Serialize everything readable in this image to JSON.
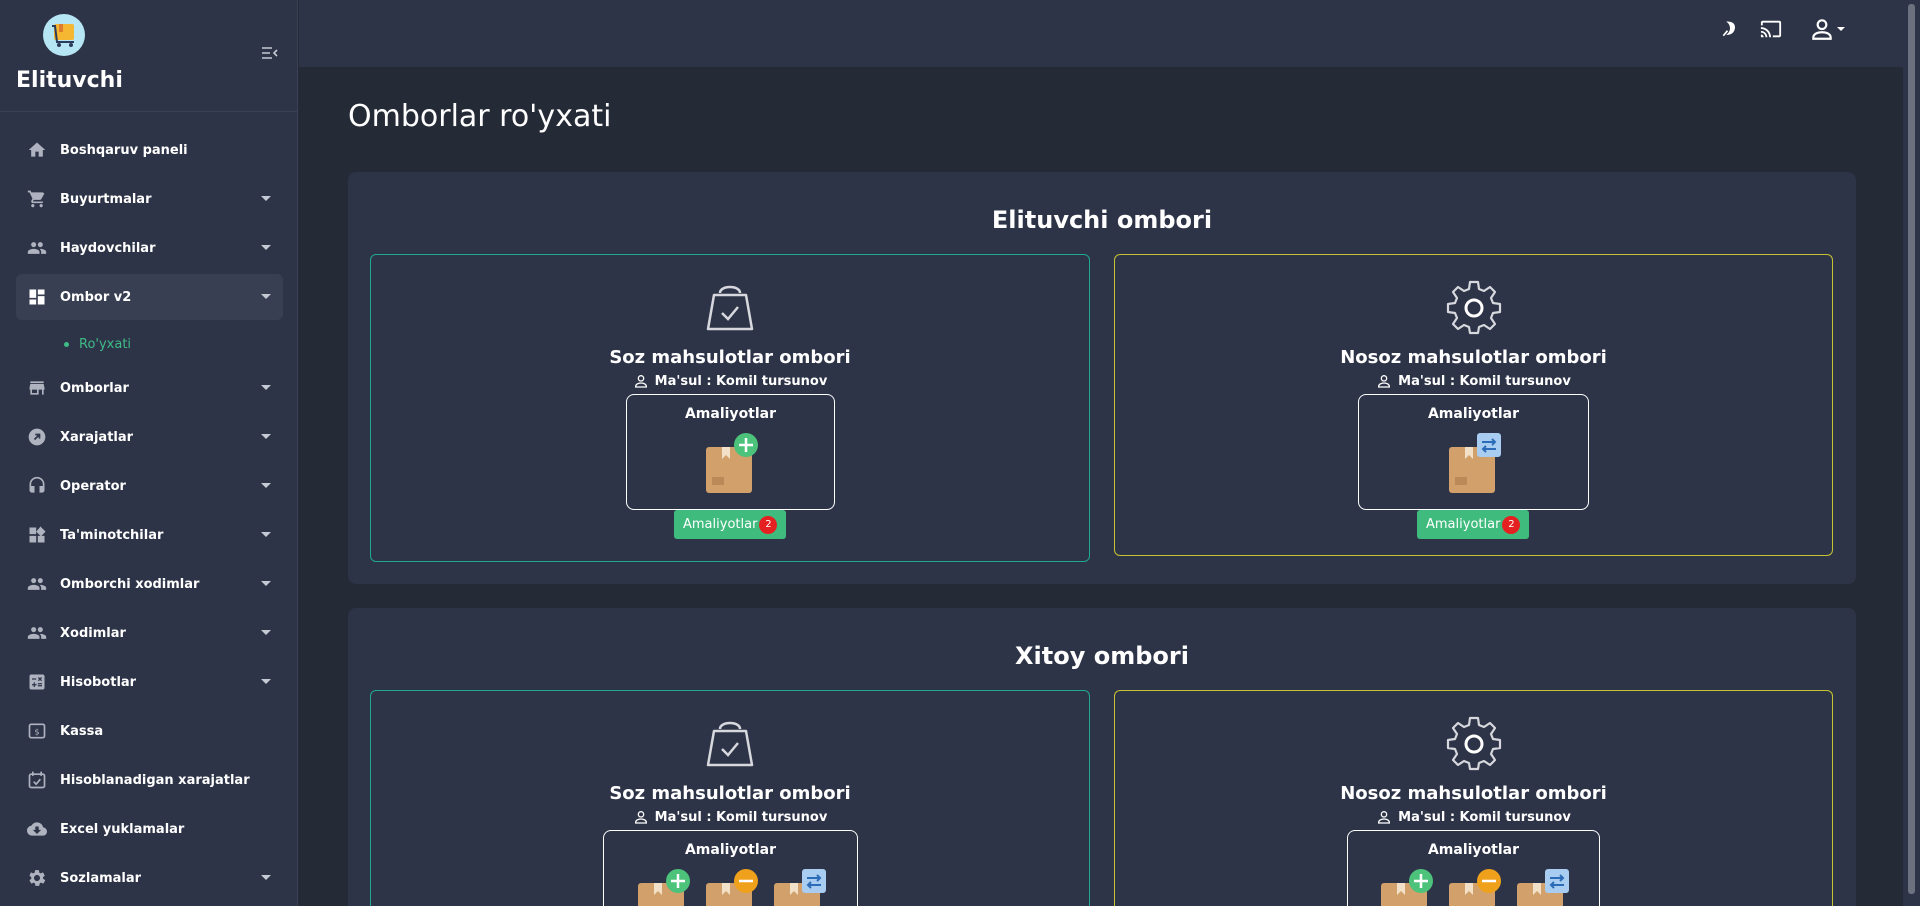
{
  "app": {
    "brand": "Elituvchi"
  },
  "sidebar": {
    "items": [
      {
        "label": "Boshqaruv paneli",
        "icon": "home-icon",
        "caret": false
      },
      {
        "label": "Buyurtmalar",
        "icon": "cart-icon",
        "caret": true
      },
      {
        "label": "Haydovchilar",
        "icon": "people-icon",
        "caret": true
      },
      {
        "label": "Ombor v2",
        "icon": "dashboard-icon",
        "caret": true,
        "active": true
      },
      {
        "label": "Omborlar",
        "icon": "store-icon",
        "caret": true
      },
      {
        "label": "Xarajatlar",
        "icon": "arrow-circle-icon",
        "caret": true
      },
      {
        "label": "Operator",
        "icon": "headset-icon",
        "caret": true
      },
      {
        "label": "Ta'minotchilar",
        "icon": "widgets-icon",
        "caret": true
      },
      {
        "label": "Omborchi xodimlar",
        "icon": "people-icon",
        "caret": true
      },
      {
        "label": "Xodimlar",
        "icon": "people-icon",
        "caret": true
      },
      {
        "label": "Hisobotlar",
        "icon": "calculator-icon",
        "caret": true
      },
      {
        "label": "Kassa",
        "icon": "cash-icon",
        "caret": false
      },
      {
        "label": "Hisoblanadigan xarajatlar",
        "icon": "calendar-icon",
        "caret": false
      },
      {
        "label": "Excel yuklamalar",
        "icon": "cloud-download-icon",
        "caret": false
      },
      {
        "label": "Sozlamalar",
        "icon": "gear-icon",
        "caret": true
      }
    ],
    "sub_item": "Ro'yxati"
  },
  "main": {
    "page_title": "Omborlar ro'yxati",
    "sections": [
      {
        "title": "Elituvchi ombori",
        "cards": [
          {
            "title": "Soz mahsulotlar ombori",
            "owner": "Ma'sul : Komil tursunov",
            "ops_title": "Amaliyotlar",
            "button": "Amaliyotlar",
            "badge": "2"
          },
          {
            "title": "Nosoz mahsulotlar ombori",
            "owner": "Ma'sul : Komil tursunov",
            "ops_title": "Amaliyotlar",
            "button": "Amaliyotlar",
            "badge": "2"
          }
        ]
      },
      {
        "title": "Xitoy ombori",
        "cards": [
          {
            "title": "Soz mahsulotlar ombori",
            "owner": "Ma'sul : Komil tursunov",
            "ops_title": "Amaliyotlar"
          },
          {
            "title": "Nosoz mahsulotlar ombori",
            "owner": "Ma'sul : Komil tursunov",
            "ops_title": "Amaliyotlar"
          }
        ]
      }
    ]
  },
  "colors": {
    "accent": "#3fbb7d",
    "teal_border": "#20a98e",
    "yellow_border": "#c7c232",
    "badge": "#e52020"
  }
}
